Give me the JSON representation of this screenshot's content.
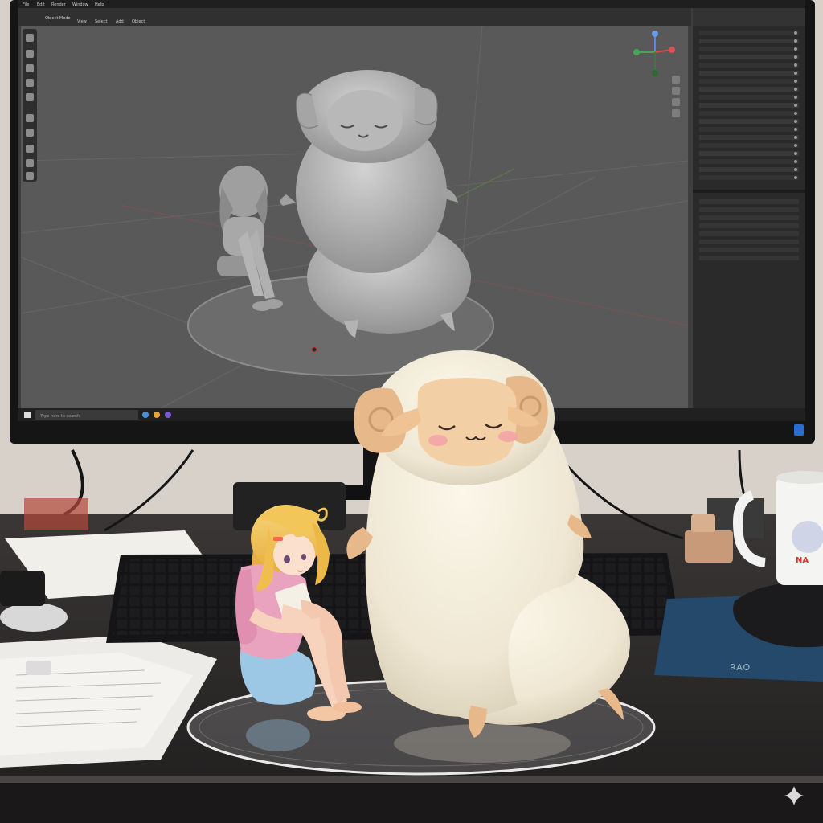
{
  "scene": {
    "description_free": true
  },
  "monitor": {
    "menu_items": [
      "File",
      "Edit",
      "Render",
      "Window",
      "Help"
    ],
    "mode_label": "Object Mode",
    "header_items": [
      "View",
      "Select",
      "Add",
      "Object"
    ],
    "taskbar_search": "Type here to search"
  },
  "mousepad": {
    "brand": "RAO"
  },
  "mug": {
    "print": "NA"
  },
  "colors": {
    "viewport": "#595959",
    "wall": "#d9d3cc",
    "desk": "#2c2a2a",
    "wool": "#f2ecdc",
    "horn": "#e7b98a",
    "face": "#f3cfa5",
    "hair": "#f1c55a",
    "sweater": "#eaa3be",
    "shorts": "#9cc8e6",
    "mousepad": "#24496a"
  },
  "icons": [
    "sparkle-icon",
    "windows-start-icon",
    "gizmo-axes-icon"
  ]
}
